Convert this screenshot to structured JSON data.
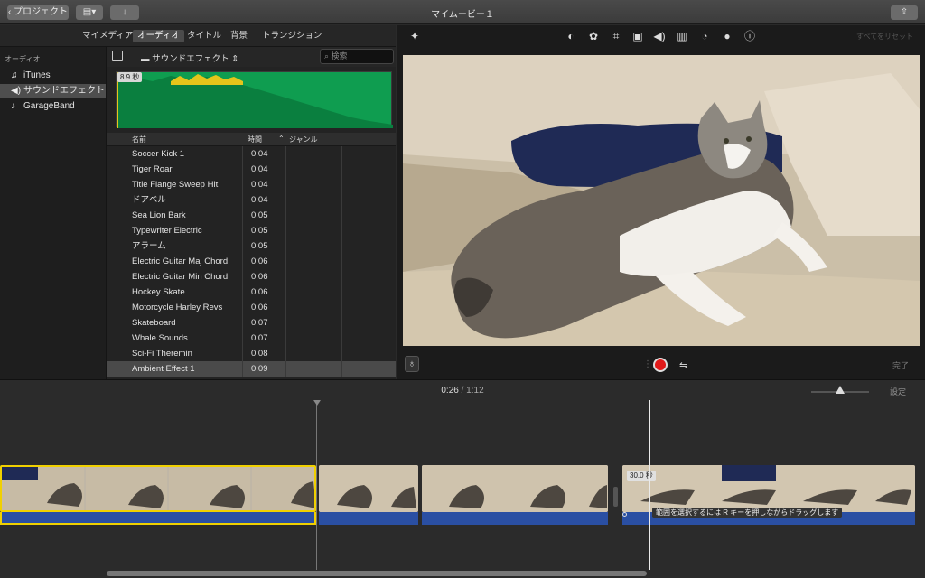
{
  "window": {
    "title": "マイムービー１"
  },
  "toolbar": {
    "back_label": "プロジェクト"
  },
  "tabs": [
    "マイメディア",
    "オーディオ",
    "タイトル",
    "背景",
    "トランジション"
  ],
  "sidebar": {
    "heading": "オーディオ",
    "items": [
      {
        "label": "iTunes",
        "icon": "music-note-icon"
      },
      {
        "label": "サウンドエフェクト",
        "icon": "speaker-icon"
      },
      {
        "label": "GarageBand",
        "icon": "guitar-icon"
      }
    ]
  },
  "library": {
    "folder": "サウンドエフェクト",
    "search_placeholder": "検索",
    "preview_duration": "8.9 秒",
    "columns": {
      "name": "名前",
      "time": "時間",
      "genre": "ジャンル"
    },
    "rows": [
      {
        "name": "Soccer Kick 1",
        "time": "0:04"
      },
      {
        "name": "Tiger Roar",
        "time": "0:04"
      },
      {
        "name": "Title Flange Sweep Hit",
        "time": "0:04"
      },
      {
        "name": "ドアベル",
        "time": "0:04"
      },
      {
        "name": "Sea Lion Bark",
        "time": "0:05"
      },
      {
        "name": "Typewriter Electric",
        "time": "0:05"
      },
      {
        "name": "アラーム",
        "time": "0:05"
      },
      {
        "name": "Electric Guitar Maj Chord",
        "time": "0:06"
      },
      {
        "name": "Electric Guitar Min Chord",
        "time": "0:06"
      },
      {
        "name": "Hockey Skate",
        "time": "0:06"
      },
      {
        "name": "Motorcycle Harley Revs",
        "time": "0:06"
      },
      {
        "name": "Skateboard",
        "time": "0:07"
      },
      {
        "name": "Whale Sounds",
        "time": "0:07"
      },
      {
        "name": "Sci-Fi Theremin",
        "time": "0:08"
      },
      {
        "name": "Ambient Effect 1",
        "time": "0:09"
      }
    ]
  },
  "viewer": {
    "reset_label": "すべてをリセット",
    "done_label": "完了"
  },
  "timeline": {
    "current": "0:26",
    "separator": "/",
    "total": "1:12",
    "settings_label": "設定",
    "clip_duration": "30.0 秒",
    "tooltip": "範囲を選択するには R キーを押しながらドラッグします"
  },
  "colors": {
    "record": "#e01818",
    "audio_track": "#2a4fa3",
    "waveform": "#0f9d50",
    "selection": "#f0d000"
  }
}
